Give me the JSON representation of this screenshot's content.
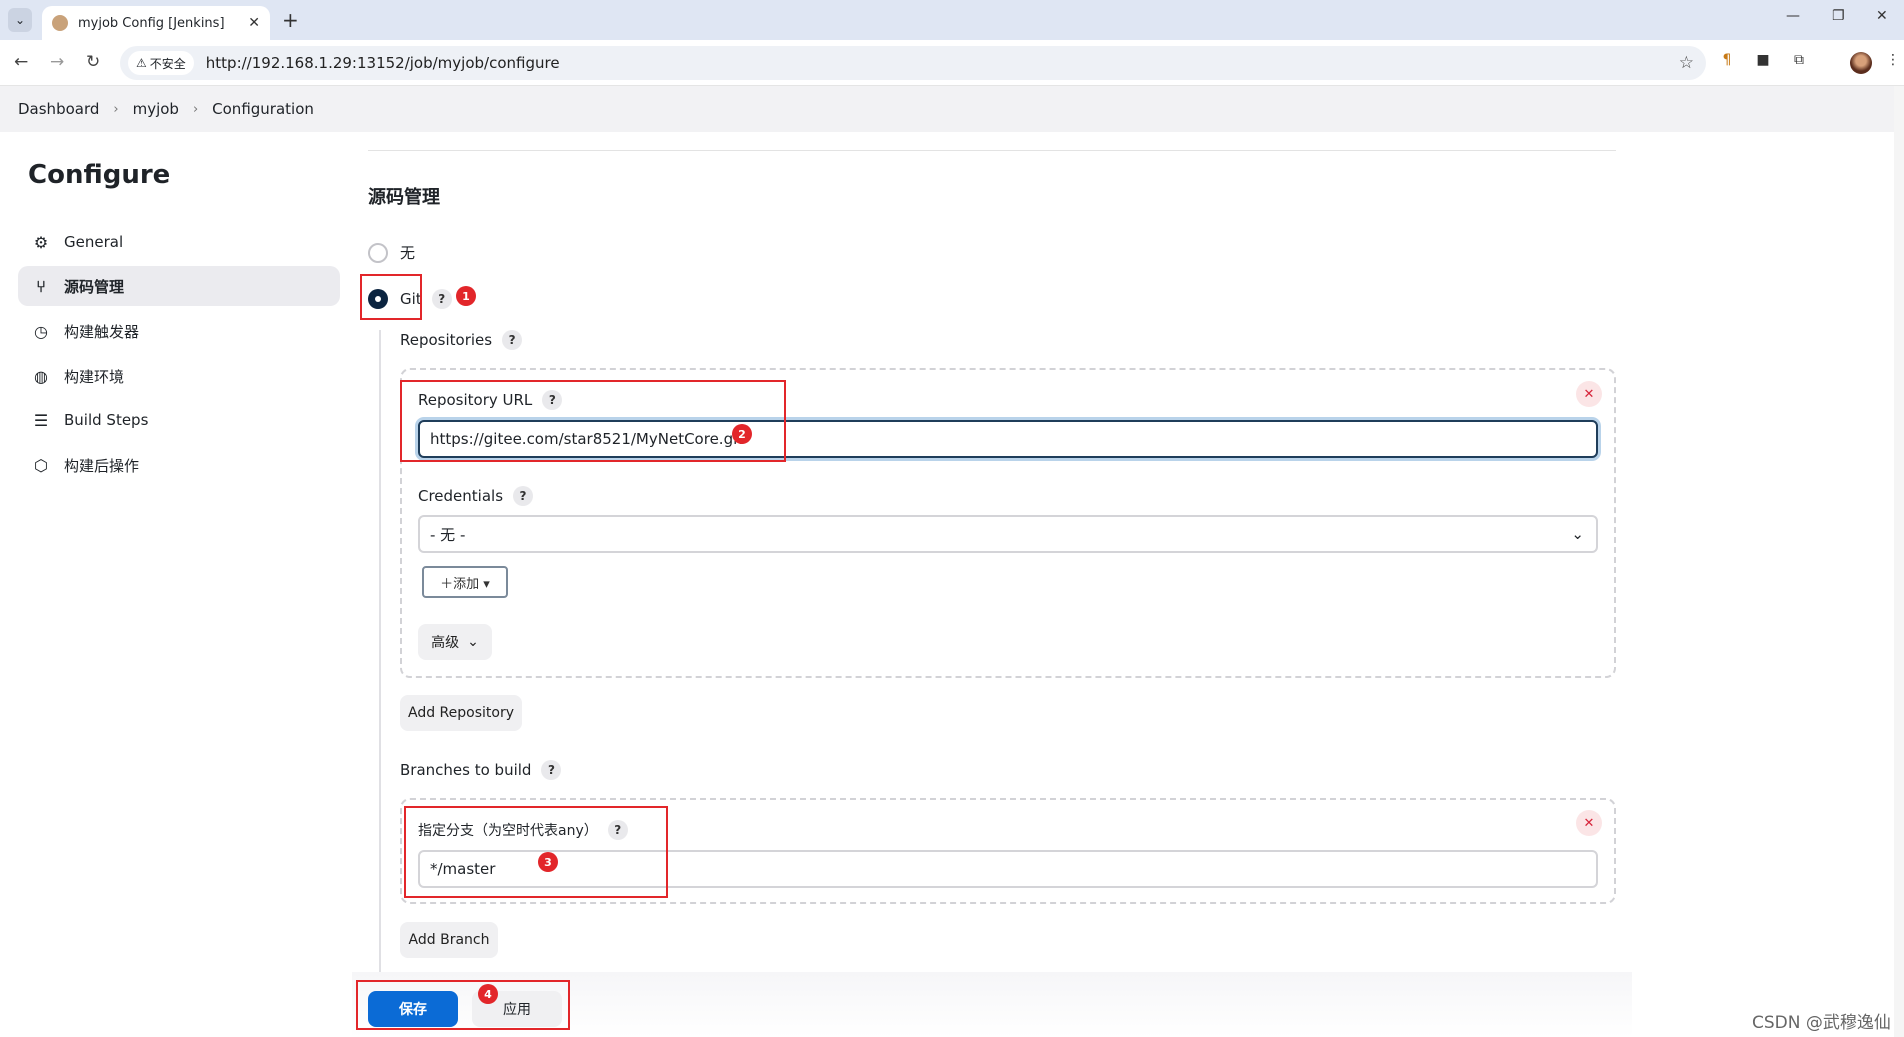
{
  "browser": {
    "tab_title": "myjob Config [Jenkins]",
    "security_label": "不安全",
    "url": "http://192.168.1.29:13152/job/myjob/configure"
  },
  "breadcrumb": [
    "Dashboard",
    "myjob",
    "Configuration"
  ],
  "sidebar": {
    "title": "Configure",
    "items": [
      {
        "label": "General",
        "icon": "gear-icon"
      },
      {
        "label": "源码管理",
        "icon": "branch-icon",
        "active": true
      },
      {
        "label": "构建触发器",
        "icon": "clock-icon"
      },
      {
        "label": "构建环境",
        "icon": "globe-icon"
      },
      {
        "label": "Build Steps",
        "icon": "list-icon"
      },
      {
        "label": "构建后操作",
        "icon": "cube-icon"
      }
    ]
  },
  "scm": {
    "section_title": "源码管理",
    "option_none": "无",
    "option_git": "Git",
    "repositories_label": "Repositories",
    "repository_url_label": "Repository URL",
    "repository_url_value": "https://gitee.com/star8521/MyNetCore.git",
    "credentials_label": "Credentials",
    "credentials_value": "- 无 -",
    "add_button": "＋添加 ▾",
    "advanced_button": "高级",
    "add_repository": "Add Repository",
    "branches_label": "Branches to build",
    "branch_spec_label": "指定分支（为空时代表any）",
    "branch_spec_value": "*/master",
    "add_branch": "Add Branch"
  },
  "footer": {
    "save": "保存",
    "apply": "应用"
  },
  "annotations": [
    "1",
    "2",
    "3",
    "4"
  ],
  "help_glyph": "?",
  "delete_glyph": "✕",
  "watermark": "CSDN @武穆逸仙",
  "colors": {
    "annotation_red": "#e2262a",
    "primary_blue": "#0b6bd6",
    "radio_checked": "#0b2440"
  }
}
